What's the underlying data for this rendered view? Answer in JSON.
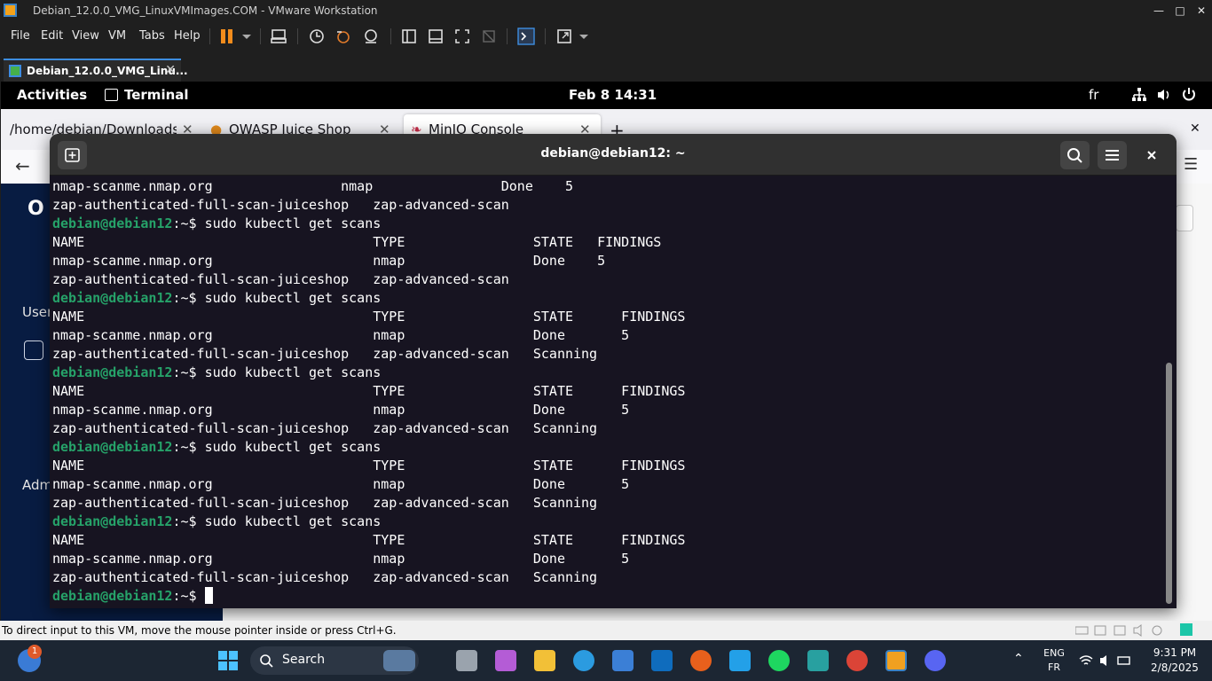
{
  "vmware": {
    "window_title": "Debian_12.0.0_VMG_LinuxVMImages.COM - VMware Workstation",
    "menu": [
      "File",
      "Edit",
      "View",
      "VM",
      "Tabs",
      "Help"
    ],
    "vm_tab_label": "Debian_12.0.0_VMG_Linu...",
    "status_message": "To direct input to this VM, move the mouse pointer inside or press Ctrl+G."
  },
  "gnome": {
    "activities": "Activities",
    "app_name": "Terminal",
    "clock": "Feb 8  14:31",
    "keyboard_layout": "fr"
  },
  "firefox": {
    "tabs": [
      {
        "label": "/home/debian/Downloads/fir"
      },
      {
        "label": "OWASP Juice Shop"
      },
      {
        "label": "MinIO Console"
      }
    ],
    "new_tab_glyph": "+",
    "sidebar_sections": [
      "User",
      "Adm"
    ]
  },
  "terminal": {
    "title": "debian@debian12: ~",
    "prompt_user": "debian@debian12",
    "prompt_suffix": ":~$ ",
    "lines": [
      {
        "kind": "out",
        "text": "nmap-scanme.nmap.org                nmap                Done    5"
      },
      {
        "kind": "out",
        "text": "zap-authenticated-full-scan-juiceshop   zap-advanced-scan"
      },
      {
        "kind": "cmd",
        "text": "sudo kubectl get scans"
      },
      {
        "kind": "out",
        "text": "NAME                                    TYPE                STATE   FINDINGS"
      },
      {
        "kind": "out",
        "text": "nmap-scanme.nmap.org                    nmap                Done    5"
      },
      {
        "kind": "out",
        "text": "zap-authenticated-full-scan-juiceshop   zap-advanced-scan"
      },
      {
        "kind": "cmd",
        "text": "sudo kubectl get scans"
      },
      {
        "kind": "out",
        "text": "NAME                                    TYPE                STATE      FINDINGS"
      },
      {
        "kind": "out",
        "text": "nmap-scanme.nmap.org                    nmap                Done       5"
      },
      {
        "kind": "out",
        "text": "zap-authenticated-full-scan-juiceshop   zap-advanced-scan   Scanning"
      },
      {
        "kind": "cmd",
        "text": "sudo kubectl get scans"
      },
      {
        "kind": "out",
        "text": "NAME                                    TYPE                STATE      FINDINGS"
      },
      {
        "kind": "out",
        "text": "nmap-scanme.nmap.org                    nmap                Done       5"
      },
      {
        "kind": "out",
        "text": "zap-authenticated-full-scan-juiceshop   zap-advanced-scan   Scanning"
      },
      {
        "kind": "cmd",
        "text": "sudo kubectl get scans"
      },
      {
        "kind": "out",
        "text": "NAME                                    TYPE                STATE      FINDINGS"
      },
      {
        "kind": "out",
        "text": "nmap-scanme.nmap.org                    nmap                Done       5"
      },
      {
        "kind": "out",
        "text": "zap-authenticated-full-scan-juiceshop   zap-advanced-scan   Scanning"
      },
      {
        "kind": "cmd",
        "text": "sudo kubectl get scans"
      },
      {
        "kind": "out",
        "text": "NAME                                    TYPE                STATE      FINDINGS"
      },
      {
        "kind": "out",
        "text": "nmap-scanme.nmap.org                    nmap                Done       5"
      },
      {
        "kind": "out",
        "text": "zap-authenticated-full-scan-juiceshop   zap-advanced-scan   Scanning"
      },
      {
        "kind": "prompt",
        "text": ""
      }
    ]
  },
  "taskbar": {
    "search_label": "Search",
    "input_lang": "ENG",
    "input_region": "FR",
    "time": "9:31 PM",
    "date": "2/8/2025",
    "notification_count": "1"
  },
  "colors": {
    "terminal_bg": "#171421",
    "prompt_green": "#26a269",
    "minio_sidebar": "#081c42",
    "vmware_accent": "#3d8de0"
  }
}
